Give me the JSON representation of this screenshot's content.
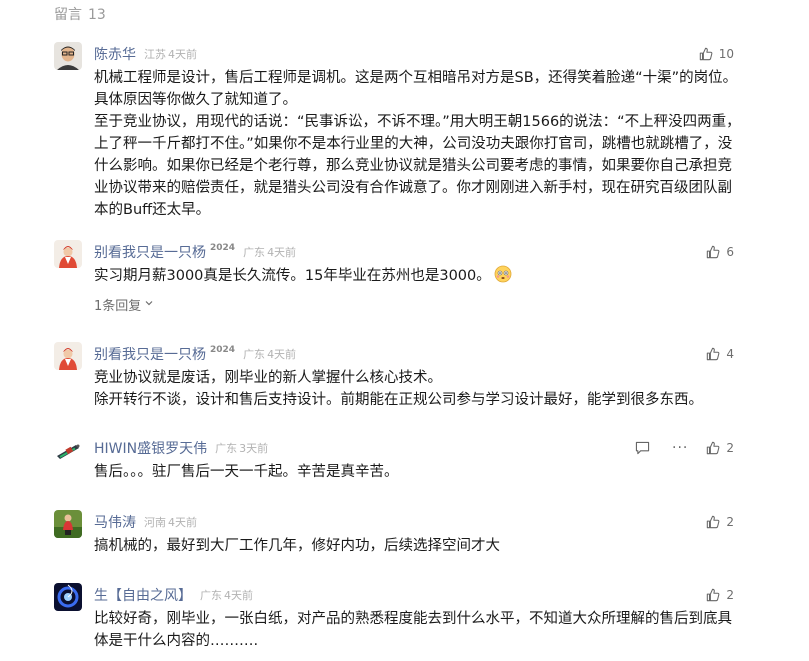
{
  "header": {
    "label": "留言",
    "count": "13"
  },
  "comments": [
    {
      "name": "陈赤华",
      "badge": "",
      "location": "江苏",
      "time": "4天前",
      "likes": "10",
      "paragraphs": [
        "机械工程师是设计，售后工程师是调机。这是两个互相暗吊对方是SB，还得笑着脸递“十渠”的岗位。具体原因等你做久了就知道了。",
        "至于竞业协议，用现代的话说：“民事诉讼，不诉不理。”用大明王朝1566的说法：“不上秤没四两重，上了秤一千斤都打不住。”如果你不是本行业里的大神，公司没功夫跟你打官司，跳槽也就跳槽了，没什么影响。如果你已经是个老行尊，那么竞业协议就是猎头公司要考虑的事情，如果要你自己承担竞业协议带来的赔偿责任，就是猎头公司没有合作诚意了。你才刚刚进入新手村，现在研究百级团队副本的Buff还太早。"
      ]
    },
    {
      "name": "别看我只是一只杨",
      "badge": "2024",
      "location": "广东",
      "time": "4天前",
      "likes": "6",
      "paragraphs": [
        "实习期月薪3000真是长久流传。15年毕业在苏州也是3000。"
      ],
      "emoji": "flushed-face",
      "replies_label": "1条回复"
    },
    {
      "name": "别看我只是一只杨",
      "badge": "2024",
      "location": "广东",
      "time": "4天前",
      "likes": "4",
      "paragraphs": [
        "竞业协议就是废话，刚毕业的新人掌握什么核心技术。",
        "除开转行不谈，设计和售后支持设计。前期能在正规公司参与学习设计最好，能学到很多东西。"
      ]
    },
    {
      "name": "HIWIN盛银罗天伟",
      "badge": "",
      "location": "广东",
      "time": "3天前",
      "likes": "2",
      "more": "···",
      "paragraphs": [
        "售后。。。驻厂售后一天一千起。辛苦是真辛苦。"
      ]
    },
    {
      "name": "马伟涛",
      "badge": "",
      "location": "河南",
      "time": "4天前",
      "likes": "2",
      "paragraphs": [
        "搞机械的，最好到大厂工作几年，修好内功，后续选择空间才大"
      ]
    },
    {
      "name": "生【自由之风】",
      "badge": "",
      "location": "广东",
      "time": "4天前",
      "likes": "2",
      "paragraphs": [
        "比较好奇，刚毕业，一张白纸，对产品的熟悉程度能去到什么水平，不知道大众所理解的售后到底具体是干什么内容的………."
      ]
    }
  ],
  "icons": {
    "like": "thumbs-up-icon",
    "reply": "comment-bubble-icon",
    "more": "more-dots-icon",
    "chevron": "chevron-down-icon"
  },
  "colors": {
    "name": "#576b95",
    "meta": "#b2b2b2",
    "text": "#1a1a1a"
  }
}
